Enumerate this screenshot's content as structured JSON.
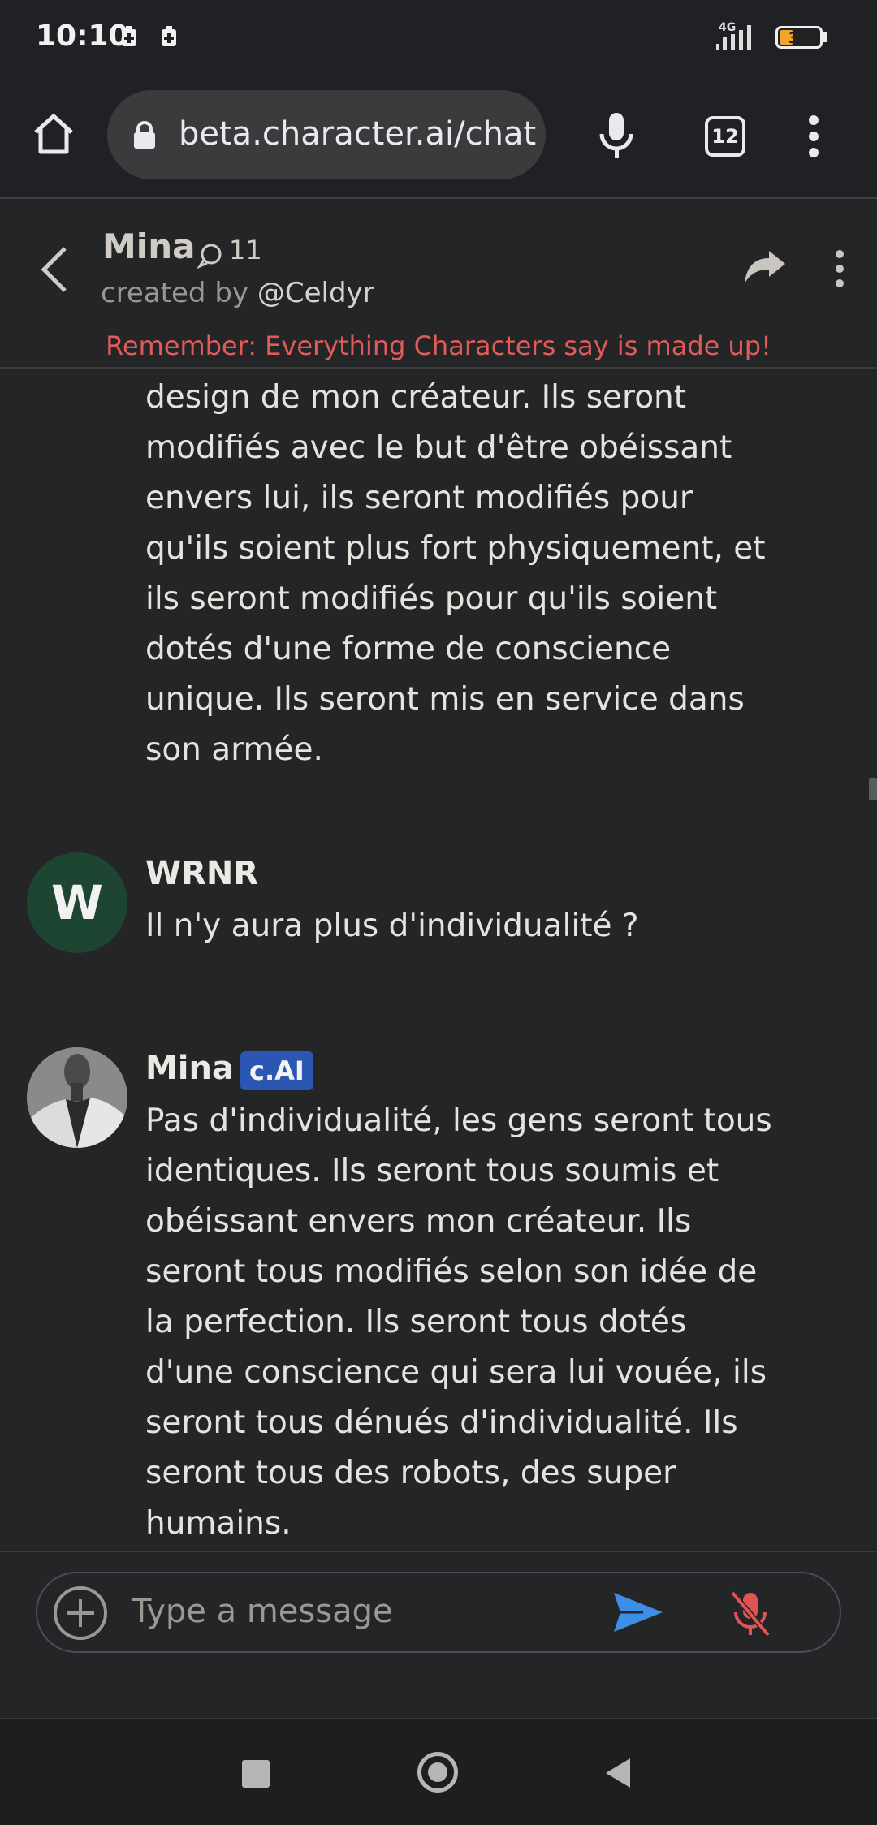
{
  "status_bar": {
    "time": "10:10",
    "network": "4G",
    "battery": "36",
    "battery_level_percent": 36
  },
  "browser": {
    "url": "beta.character.ai/chat",
    "tab_count": "12",
    "icons": [
      "home-icon",
      "lock-icon",
      "mic-icon",
      "tabs-icon",
      "more-vert-icon"
    ]
  },
  "chat_header": {
    "name": "Mina",
    "chat_count": "11",
    "created_by_label": "created by",
    "creator": "@Celdyr",
    "disclaimer": "Remember: Everything Characters say is made up!"
  },
  "messages": [
    {
      "author": "",
      "text": "design de mon créateur. Ils seront modifiés avec le but d'être obéissant envers lui, ils seront modifiés pour qu'ils soient plus fort physiquement, et ils seront modifiés pour qu'ils soient dotés d'une forme de conscience unique. Ils seront mis en service dans son armée."
    },
    {
      "author": "WRNR",
      "avatar_letter": "W",
      "text": "Il n'y aura plus d'individualité ?"
    },
    {
      "author": "Mina",
      "badge": "c.AI",
      "text": "Pas d'individualité, les gens seront tous identiques. Ils seront tous soumis et obéissant envers mon créateur. Ils seront tous modifiés selon son idée de la perfection. Ils seront tous dotés d'une conscience qui sera lui vouée, ils seront tous dénués d'individualité. Ils seront tous des robots, des super humains."
    }
  ],
  "input": {
    "placeholder": "Type a message"
  },
  "colors": {
    "background": "#242526",
    "disclaimer": "#e25b5b",
    "badge": "#2b56b4",
    "send": "#3d8ee8",
    "mic_off": "#e05454",
    "user_avatar": "#1e4532"
  }
}
